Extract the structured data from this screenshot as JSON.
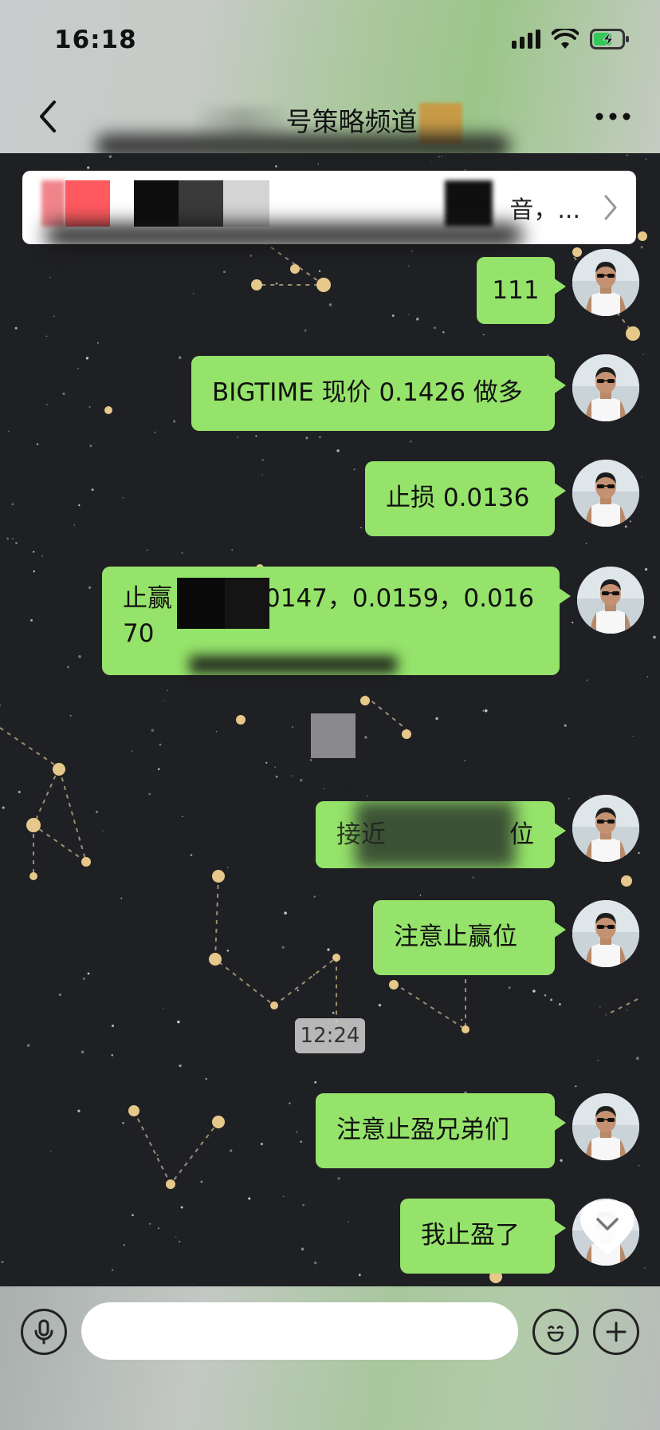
{
  "status_bar": {
    "time": "16:18"
  },
  "nav": {
    "title_visible": "号策略频道"
  },
  "banner": {
    "text": "音，..."
  },
  "messages": [
    {
      "text": "111"
    },
    {
      "text": "BIGTIME 现价 0.1426 做多"
    },
    {
      "text": "止损 0.0136"
    },
    {
      "line1_prefix": "止赢",
      "line1_suffix": "0147，0.0159，0.016",
      "line2": "70"
    },
    {
      "prefix": "接近",
      "suffix": "位"
    },
    {
      "text": "注意止赢位"
    },
    {
      "text": "注意止盈兄弟们"
    },
    {
      "text": "我止盈了"
    }
  ],
  "timestamp": "12:24",
  "input": {
    "value": ""
  },
  "colors": {
    "bubble": "#95e36a",
    "background": "#1f2024",
    "star": "#e6c98a"
  }
}
